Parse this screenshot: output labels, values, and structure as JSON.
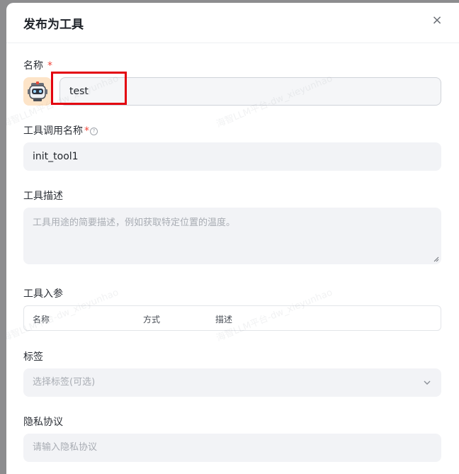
{
  "modal": {
    "title": "发布为工具",
    "close_label": "×"
  },
  "form": {
    "name": {
      "label": "名称",
      "required_mark": "*",
      "value": "test"
    },
    "tool_call_name": {
      "label": "工具调用名称",
      "required_mark": "*",
      "help_icon": "?",
      "value": "init_tool1"
    },
    "description": {
      "label": "工具描述",
      "placeholder": "工具用途的简要描述，例如获取特定位置的温度。"
    },
    "params": {
      "label": "工具入参",
      "columns": [
        "名称",
        "方式",
        "描述"
      ]
    },
    "tags": {
      "label": "标签",
      "placeholder": "选择标签(可选)"
    },
    "privacy": {
      "label": "隐私协议",
      "placeholder": "请输入隐私协议"
    }
  },
  "watermark_text": "海智LLM平台-dw_xieyunhao",
  "colors": {
    "required": "#f04438",
    "highlight": "#e3000f",
    "avatar_bg": "#fde4c8"
  }
}
